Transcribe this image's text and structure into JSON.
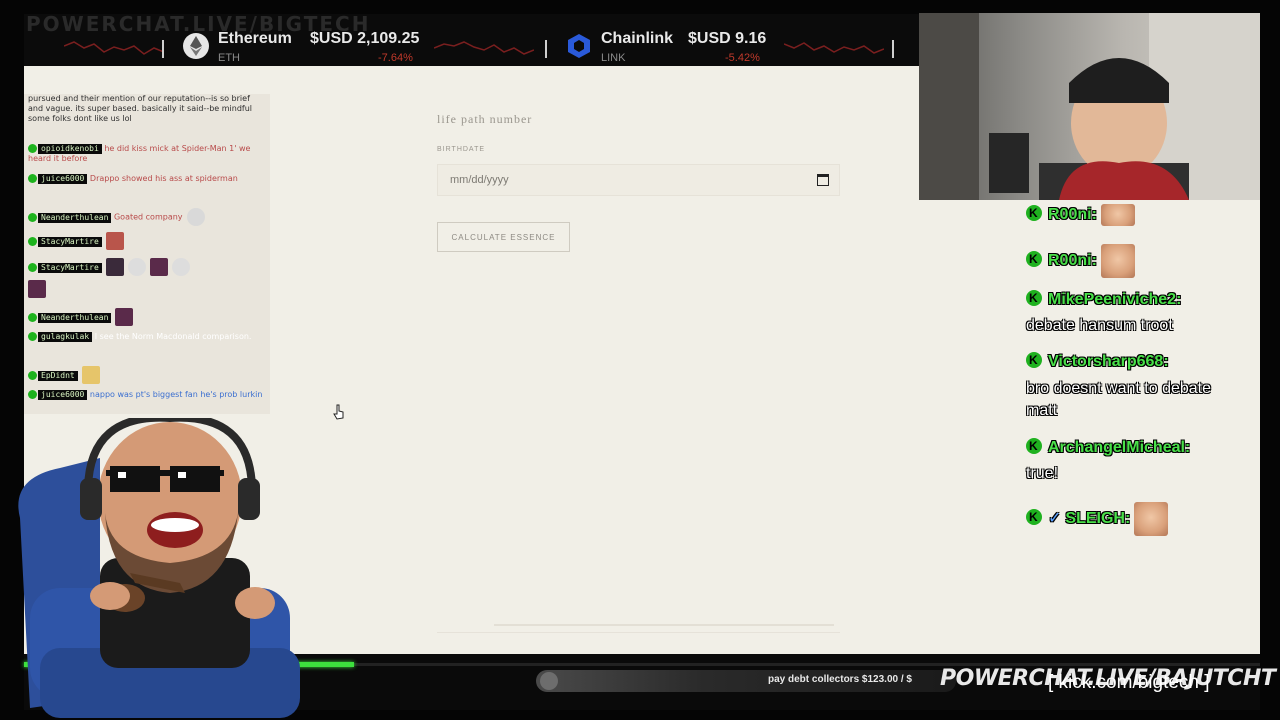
{
  "ticker": {
    "watermark": "POWERCHAT.LIVE/BIGTECH",
    "items": [
      {
        "name": "Ethereum",
        "symbol": "ETH",
        "price": "$USD 2,109.25",
        "change": "-7.64%"
      },
      {
        "name": "Chainlink",
        "symbol": "LINK",
        "price": "$USD 9.16",
        "change": "-5.42%"
      }
    ],
    "icons": {
      "ethereum": "ethereum-icon",
      "chainlink": "chainlink-icon"
    }
  },
  "page": {
    "title": "life path number",
    "birthdate_label": "BIRTHDATE",
    "birthdate_placeholder": "mm/dd/yyyy",
    "button_label": "CALCULATE ESSENCE"
  },
  "left_chat": {
    "messages": [
      {
        "user": "",
        "text": "pursued and their mention of our reputation--is so brief and vague. its super based. basically it said--be mindful some folks dont like us lol"
      },
      {
        "user": "opioidkenobi",
        "text": "he did kiss mick at Spider-Man 1' we heard it before"
      },
      {
        "user": "juice6000",
        "text": "Drappo showed his ass at spiderman"
      },
      {
        "user": "Neanderthulean",
        "text": "Goated company"
      },
      {
        "user": "StacyMartire",
        "text": ""
      },
      {
        "user": "StacyMartire",
        "text": ""
      },
      {
        "user": "Neanderthulean",
        "text": ""
      },
      {
        "user": "gulagkulak",
        "text": "I see the Norm Macdonald comparison."
      },
      {
        "user": "EpDidnt",
        "text": ""
      },
      {
        "user": "juice6000",
        "text": "nappo was pt's biggest fan he's prob lurkin"
      }
    ]
  },
  "right_chat": {
    "messages": [
      {
        "user": "R00ni:",
        "text": ""
      },
      {
        "user": "R00ni:",
        "text": ""
      },
      {
        "user": "MikePeeniviche2:",
        "text": "debate hansum troot"
      },
      {
        "user": "Victorsharp668:",
        "text": "bro doesnt want to debate matt"
      },
      {
        "user": "ArchangelMicheal:",
        "text": "true!"
      },
      {
        "user": "SLEIGH:",
        "text": ""
      }
    ]
  },
  "bottom": {
    "donation": "pay debt collectors $123.00 / $",
    "brand": "POWERCHAT.LIVE/BAJUTCHT",
    "kick": "[ kick.com/bigtech ]",
    "progress_fraction": 0.27
  },
  "colors": {
    "page_bg": "#f1efe7",
    "chat_green": "#49e049",
    "progress_green": "#3de03d",
    "negative": "#c0392b"
  }
}
